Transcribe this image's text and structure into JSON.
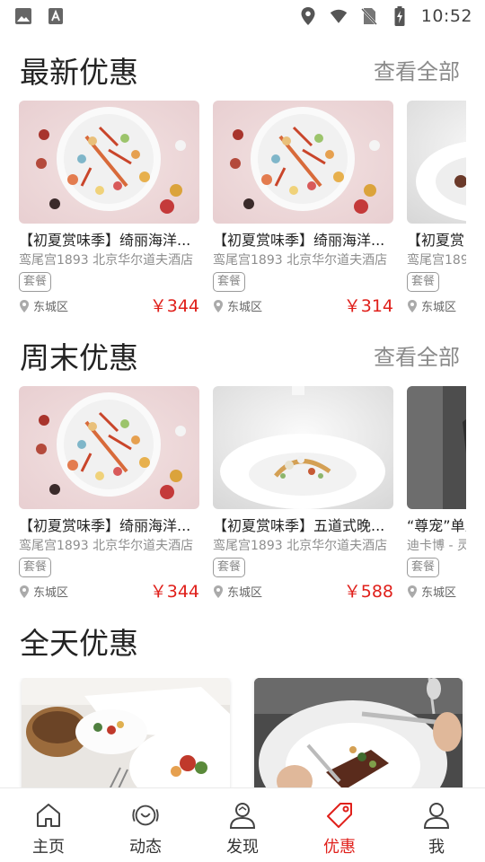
{
  "status_bar": {
    "time": "10:52"
  },
  "sections": [
    {
      "title": "最新优惠",
      "see_all": "查看全部",
      "cards": [
        {
          "title": "【初夏赏味季】绮丽海洋...",
          "venue": "鸾尾宫1893 北京华尔道夫酒店",
          "tag": "套餐",
          "district": "东城区",
          "price": "￥344"
        },
        {
          "title": "【初夏赏味季】绮丽海洋...",
          "venue": "鸾尾宫1893 北京华尔道夫酒店",
          "tag": "套餐",
          "district": "东城区",
          "price": "￥314"
        },
        {
          "title": "【初夏赏",
          "venue": "鸾尾宫189",
          "tag": "套餐",
          "district": "东城区",
          "price": ""
        }
      ]
    },
    {
      "title": "周末优惠",
      "see_all": "查看全部",
      "cards": [
        {
          "title": "【初夏赏味季】绮丽海洋...",
          "venue": "鸾尾宫1893 北京华尔道夫酒店",
          "tag": "套餐",
          "district": "东城区",
          "price": "￥344"
        },
        {
          "title": "【初夏赏味季】五道式晚...",
          "venue": "鸾尾宫1893 北京华尔道夫酒店",
          "tag": "套餐",
          "district": "东城区",
          "price": "￥588"
        },
        {
          "title": "“尊宠”单人",
          "venue": "迪卡博 - 灵",
          "tag": "套餐",
          "district": "东城区",
          "price": ""
        }
      ]
    },
    {
      "title": "全天优惠"
    }
  ],
  "nav": [
    {
      "label": "主页",
      "icon": "home-icon"
    },
    {
      "label": "动态",
      "icon": "moments-icon"
    },
    {
      "label": "发现",
      "icon": "discover-icon"
    },
    {
      "label": "优惠",
      "icon": "tag-icon",
      "active": true
    },
    {
      "label": "我",
      "icon": "profile-icon"
    }
  ],
  "colors": {
    "accent": "#e0201b",
    "muted": "#8a8a8a"
  }
}
